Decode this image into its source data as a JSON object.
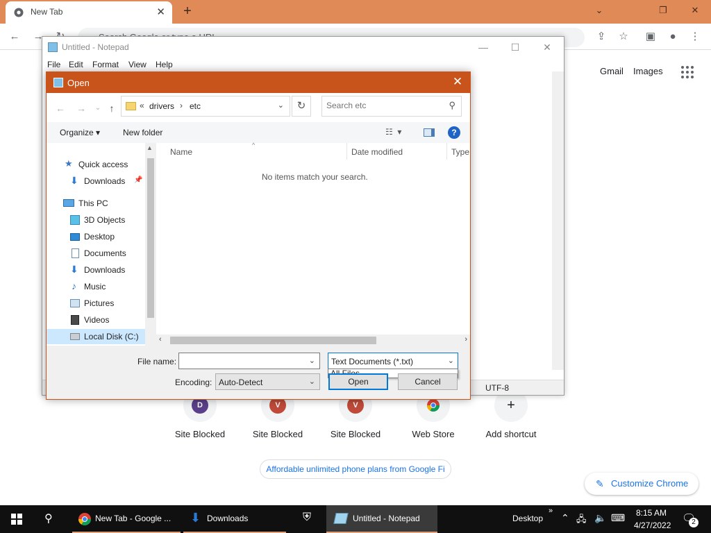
{
  "chrome": {
    "tab_title": "New Tab",
    "omnibox_placeholder": "Search Google or type a URL",
    "header_links": [
      "Gmail",
      "Images"
    ],
    "shortcuts": [
      {
        "label": "Site Blocked",
        "letter": "D",
        "color": "#5b3f8a"
      },
      {
        "label": "Site Blocked",
        "letter": "V",
        "color": "#c04a3a"
      },
      {
        "label": "Site Blocked",
        "letter": "V",
        "color": "#c04a3a"
      },
      {
        "label": "Web Store",
        "letter": "",
        "color": ""
      },
      {
        "label": "Add shortcut",
        "letter": "+",
        "color": ""
      }
    ],
    "promo_text": "Affordable unlimited phone plans from Google Fi",
    "customize_label": "Customize Chrome",
    "accent": "#e08a58"
  },
  "notepad": {
    "title": "Untitled - Notepad",
    "menu": [
      "File",
      "Edit",
      "Format",
      "View",
      "Help"
    ],
    "status_encoding": "UTF-8"
  },
  "dialog": {
    "title": "Open",
    "address": {
      "chevron": "«",
      "part1": "drivers",
      "part2": "etc"
    },
    "search_placeholder": "Search etc",
    "organize_label": "Organize",
    "new_folder_label": "New folder",
    "nav_items": [
      {
        "label": "Quick access",
        "icon": "star-icon"
      },
      {
        "label": "Downloads",
        "icon": "download-icon"
      },
      {
        "label": "This PC",
        "icon": "pc-icon"
      },
      {
        "label": "3D Objects",
        "icon": "cube-icon"
      },
      {
        "label": "Desktop",
        "icon": "desktop-icon"
      },
      {
        "label": "Documents",
        "icon": "document-icon"
      },
      {
        "label": "Downloads",
        "icon": "download-icon"
      },
      {
        "label": "Music",
        "icon": "music-icon"
      },
      {
        "label": "Pictures",
        "icon": "picture-icon"
      },
      {
        "label": "Videos",
        "icon": "video-icon"
      },
      {
        "label": "Local Disk (C:)",
        "icon": "drive-icon"
      }
    ],
    "columns": [
      "Name",
      "Date modified",
      "Type"
    ],
    "empty_message": "No items match your search.",
    "file_name_label": "File name:",
    "file_name_value": "",
    "filter_value": "Text Documents (*.txt)",
    "filter_option_visible": "All Files",
    "encoding_label": "Encoding:",
    "encoding_value": "Auto-Detect",
    "open_label": "Open",
    "cancel_label": "Cancel",
    "title_color": "#c9541b"
  },
  "taskbar": {
    "items": [
      "New Tab - Google ...",
      "Downloads",
      "Untitled - Notepad"
    ],
    "desktop_label": "Desktop",
    "time": "8:15 AM",
    "date": "4/27/2022",
    "notification_count": "2"
  }
}
